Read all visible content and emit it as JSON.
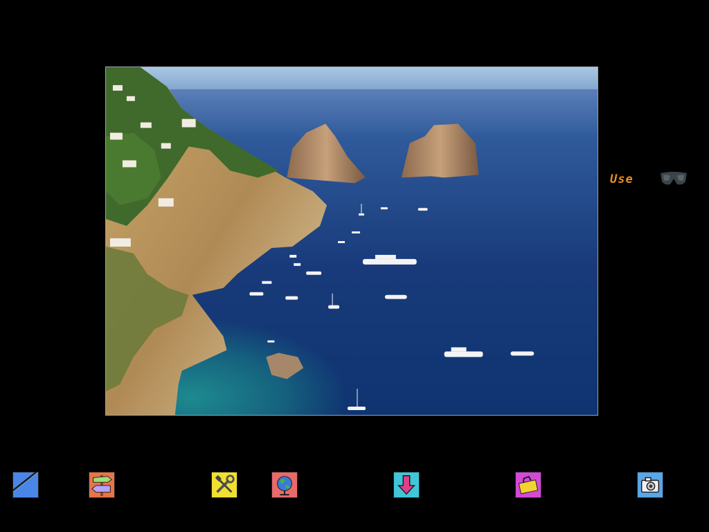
{
  "inventory": {
    "use_label": "Use",
    "selected_item_icon": "sunglasses-icon"
  },
  "scene": {
    "description_icon": "capri-faraglioni-view"
  },
  "toolbar": {
    "tools": [
      {
        "name": "notebook-pen-icon",
        "color": "#4a86e8"
      },
      {
        "name": "signpost-icon",
        "color": "#e8744a"
      },
      {
        "name": "tools-icon",
        "color": "#f2e030"
      },
      {
        "name": "globe-icon",
        "color": "#e86a6a"
      },
      {
        "name": "down-arrow-icon",
        "color": "#3fc6d8"
      },
      {
        "name": "toolbox-icon",
        "color": "#d24ad6"
      },
      {
        "name": "camera-icon",
        "color": "#5aa6e6"
      }
    ]
  },
  "colors": {
    "accent_orange": "#f28c1e",
    "background": "#000000"
  }
}
